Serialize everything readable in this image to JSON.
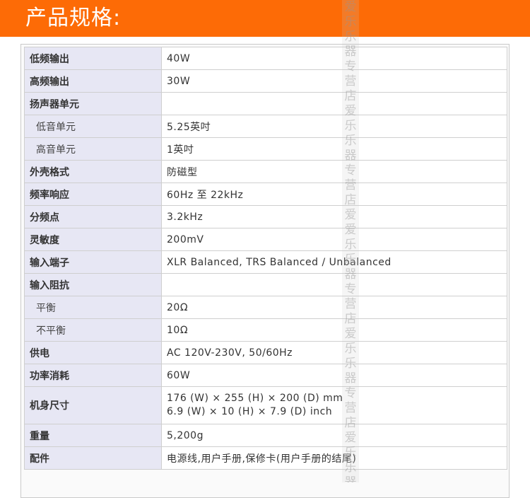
{
  "header": {
    "title": "产品规格:"
  },
  "specs": [
    {
      "label": "低频输出",
      "value": "40W",
      "sub": false
    },
    {
      "label": "高频输出",
      "value": "30W",
      "sub": false
    },
    {
      "label": "扬声器单元",
      "value": "",
      "sub": false
    },
    {
      "label": "低音单元",
      "value": "5.25英吋",
      "sub": true
    },
    {
      "label": "高音单元",
      "value": "1英吋",
      "sub": true
    },
    {
      "label": "外壳格式",
      "value": "防磁型",
      "sub": false
    },
    {
      "label": "频率响应",
      "value": "60Hz 至 22kHz",
      "sub": false
    },
    {
      "label": "分频点",
      "value": "3.2kHz",
      "sub": false
    },
    {
      "label": "灵敏度",
      "value": "200mV",
      "sub": false
    },
    {
      "label": "输入端子",
      "value": "XLR Balanced, TRS Balanced / Unbalanced",
      "sub": false
    },
    {
      "label": "输入阻抗",
      "value": "",
      "sub": false
    },
    {
      "label": "平衡",
      "value": "20Ω",
      "sub": true
    },
    {
      "label": "不平衡",
      "value": "10Ω",
      "sub": true
    },
    {
      "label": "供电",
      "value": "AC 120V-230V, 50/60Hz",
      "sub": false
    },
    {
      "label": "功率消耗",
      "value": "60W",
      "sub": false
    },
    {
      "label": "机身尺寸",
      "value": "176 (W) × 255 (H) × 200 (D) mm",
      "value2": "6.9 (W) × 10 (H) × 7.9 (D) inch",
      "sub": false
    },
    {
      "label": "重量",
      "value": "5,200g",
      "sub": false
    },
    {
      "label": "配件",
      "value": "电源线,用户手册,保修卡(用户手册的结尾)",
      "sub": false
    }
  ],
  "watermark": {
    "text": "爱乐乐器专营店 爱乐乐器专营店爱 爱乐乐器专营店 爱乐乐器专营店 爱乐乐器专营店"
  }
}
